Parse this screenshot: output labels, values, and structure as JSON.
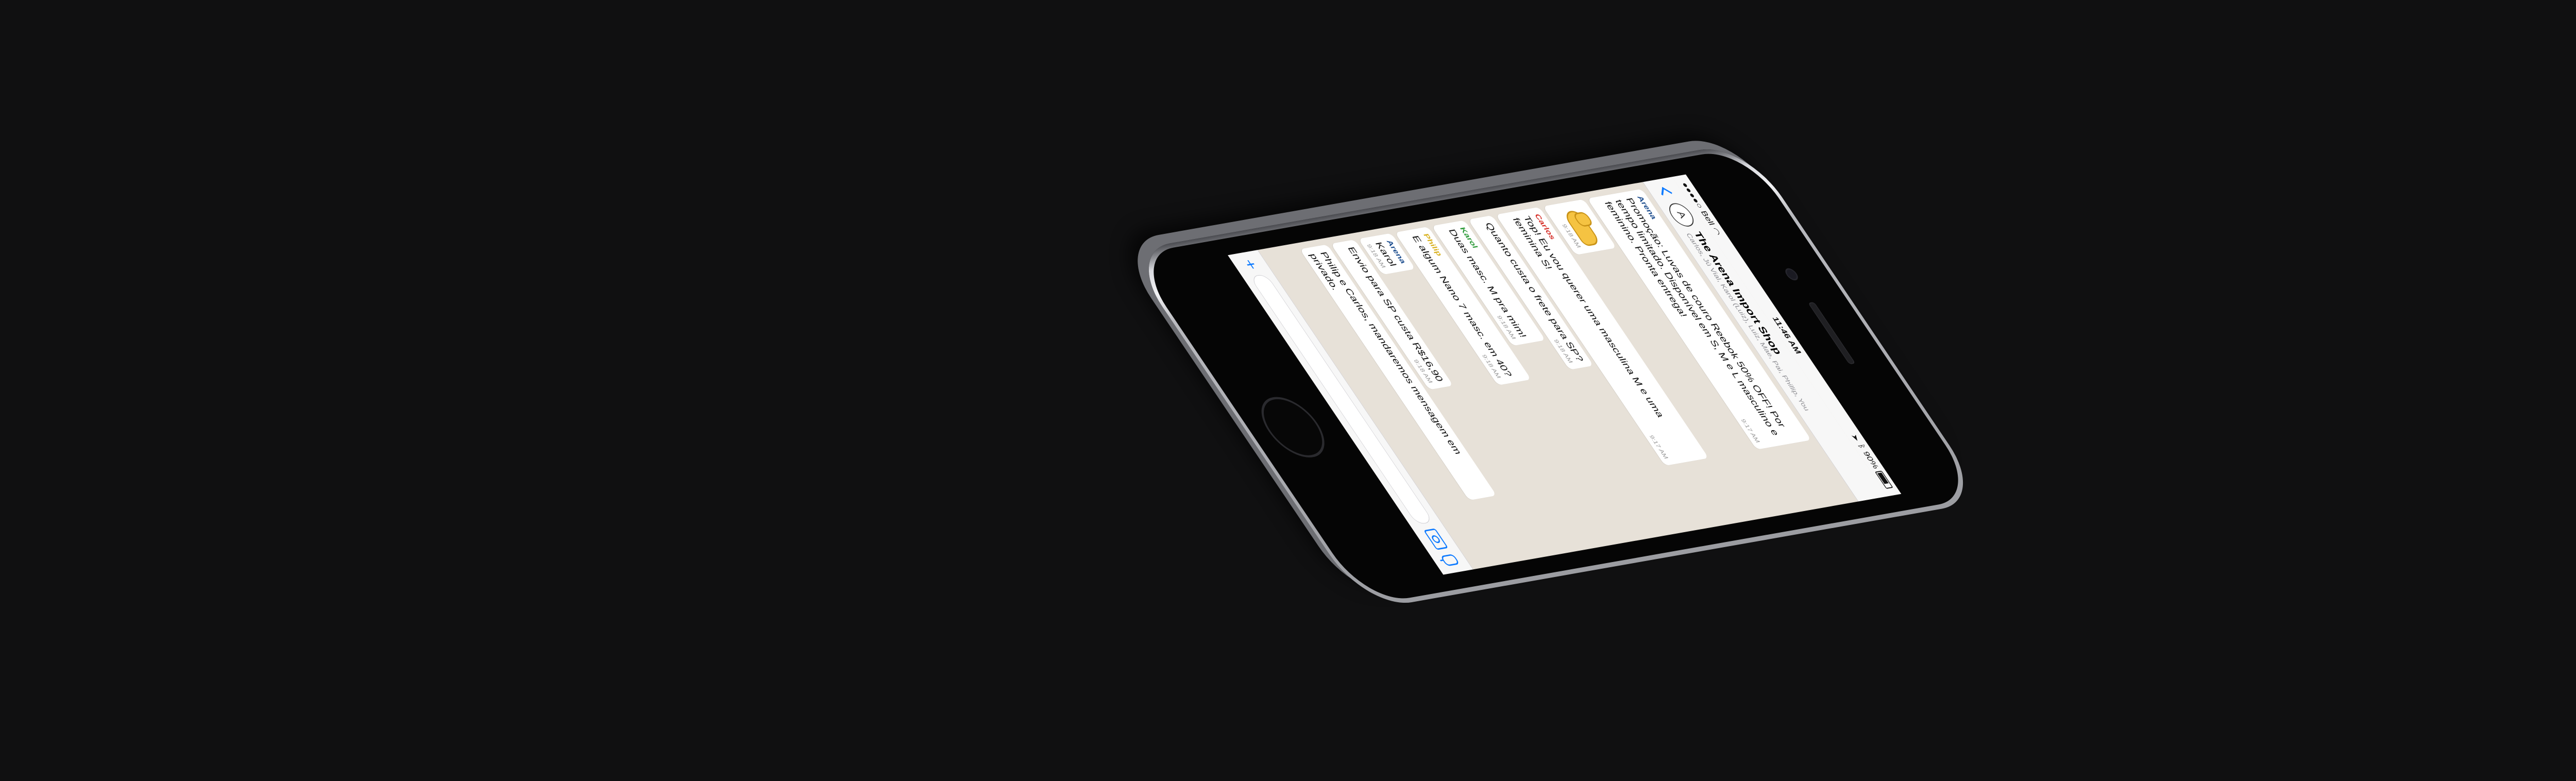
{
  "status_bar": {
    "carrier": "Bell",
    "time": "11:46 AM",
    "battery": "90%",
    "battery_level": 0.9
  },
  "header": {
    "title": "The Arena Import Shop",
    "members": "Carlos, Jú Vial, Karol (Luiz), Luiz, Mae, Pai, Phillip, You"
  },
  "messages": [
    {
      "sender": "Arena",
      "sender_color": "#1f4f8f",
      "text": "Promoção: Luvas de couro Reebok 50% OFF! Por tempo limitado. Disponível em S, M e L masculino e feminino. Pronta entrega!",
      "time": "9:17 AM"
    },
    {
      "sender": "",
      "sender_color": "",
      "text": "",
      "time": "9:18 AM",
      "sticker": "flexed-biceps-icon"
    },
    {
      "sender": "Carlos",
      "sender_color": "#d6312a",
      "text": "Top! Eu vou querer uma masculina M e uma feminina S!",
      "time": "9:17 AM"
    },
    {
      "sender": "",
      "sender_color": "",
      "text": "Quanto custa o frete para SP?",
      "time": "9:18 AM"
    },
    {
      "sender": "Karol",
      "sender_color": "#2e9b3a",
      "text": "Duas masc. M pra mim!",
      "time": "9:18 AM"
    },
    {
      "sender": "Philip",
      "sender_color": "#d9b11f",
      "text": "E algum Nano 7 masc. em 40?",
      "time": "9:18 AM"
    },
    {
      "sender": "Arena",
      "sender_color": "#1f4f8f",
      "text": "Karol",
      "time": "9:18 AM"
    },
    {
      "sender": "",
      "sender_color": "",
      "text": "Envio para SP custa R$16,90",
      "time": "9:18 AM"
    },
    {
      "sender": "",
      "sender_color": "",
      "text": "Philip e Carlos, mandaremos mensagem em privado.",
      "time": ""
    }
  ],
  "input": {
    "placeholder": ""
  }
}
